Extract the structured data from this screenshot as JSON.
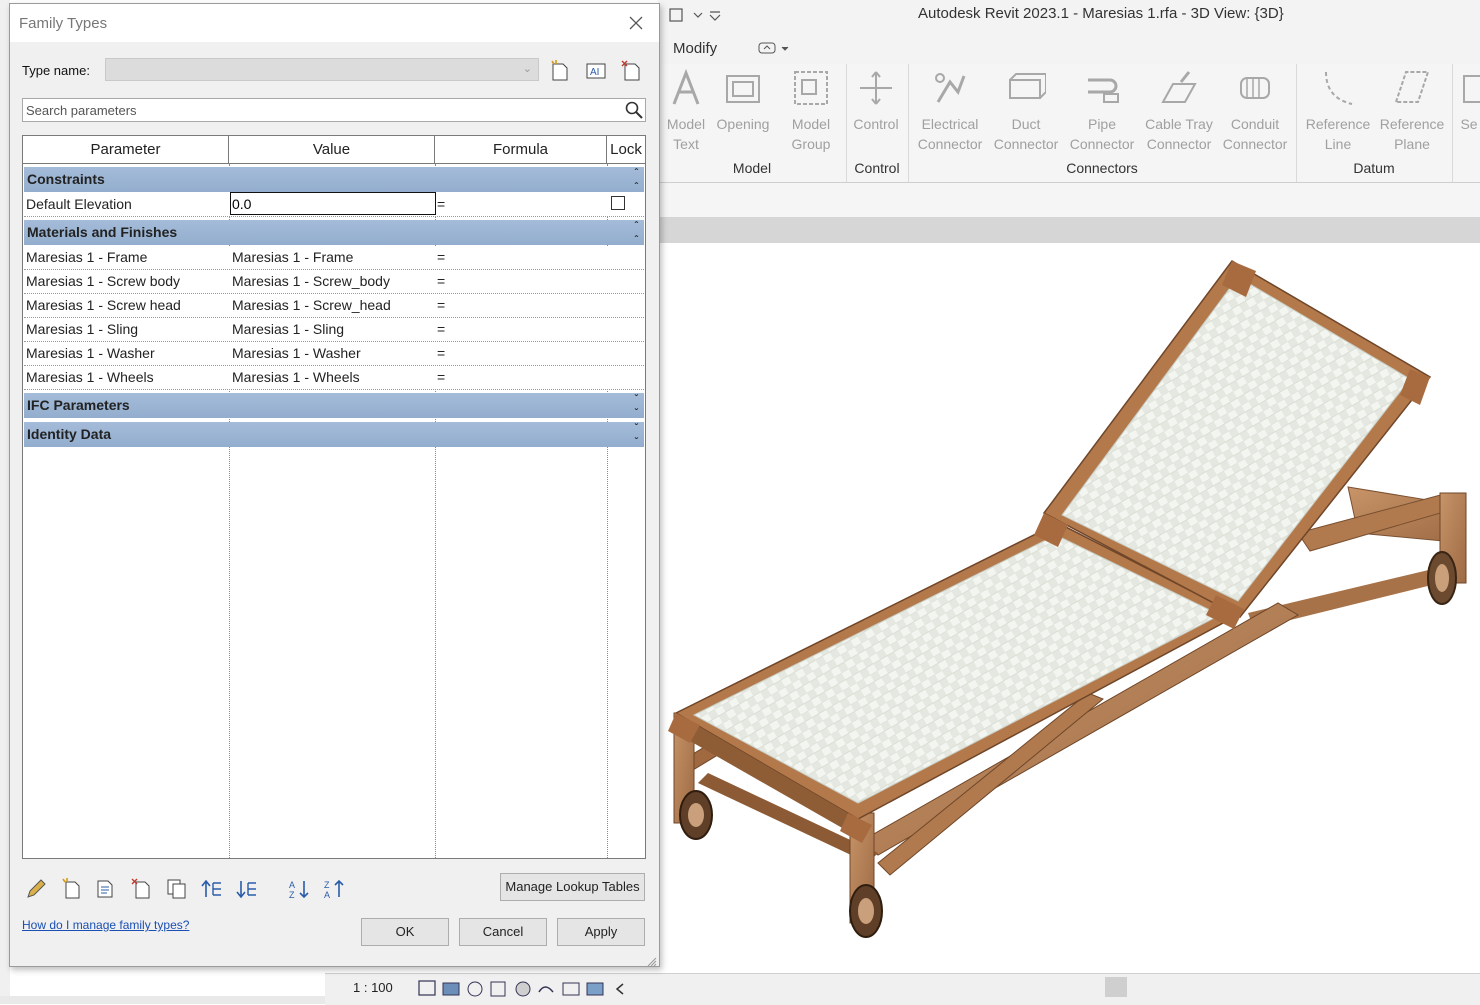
{
  "app": {
    "window_title": "Autodesk Revit 2023.1 - Maresias 1.rfa - 3D View: {3D}",
    "tab_modify": "Modify",
    "ribbon": {
      "buttons": [
        {
          "line1": "Model",
          "line2": "Text",
          "icon": "model-text-icon"
        },
        {
          "line1": "Opening",
          "line2": "",
          "icon": "opening-icon"
        },
        {
          "line1": "Model",
          "line2": "Group",
          "icon": "model-group-icon"
        },
        {
          "line1": "Control",
          "line2": "",
          "icon": "control-icon"
        },
        {
          "line1": "Electrical",
          "line2": "Connector",
          "icon": "electrical-connector-icon"
        },
        {
          "line1": "Duct",
          "line2": "Connector",
          "icon": "duct-connector-icon"
        },
        {
          "line1": "Pipe",
          "line2": "Connector",
          "icon": "pipe-connector-icon"
        },
        {
          "line1": "Cable Tray",
          "line2": "Connector",
          "icon": "cable-tray-connector-icon"
        },
        {
          "line1": "Conduit",
          "line2": "Connector",
          "icon": "conduit-connector-icon"
        },
        {
          "line1": "Reference",
          "line2": "Line",
          "icon": "reference-line-icon"
        },
        {
          "line1": "Reference",
          "line2": "Plane",
          "icon": "reference-plane-icon"
        },
        {
          "line1": "Se",
          "line2": "",
          "icon": "set-icon"
        }
      ],
      "panels": [
        "Model",
        "Control",
        "Connectors",
        "Datum"
      ]
    },
    "status": {
      "scale": "1 : 100"
    }
  },
  "dialog": {
    "title": "Family Types",
    "type_name_label": "Type name:",
    "search_placeholder": "Search parameters",
    "columns": [
      "Parameter",
      "Value",
      "Formula",
      "Lock"
    ],
    "groups": {
      "constraints": {
        "label": "Constraints",
        "rows": [
          {
            "param": "Default Elevation",
            "value": "0.0",
            "formula": "=",
            "lock": false
          }
        ]
      },
      "materials": {
        "label": "Materials and Finishes",
        "rows": [
          {
            "param": "Maresias 1 - Frame",
            "value": "Maresias 1 - Frame",
            "formula": "="
          },
          {
            "param": "Maresias 1 - Screw body",
            "value": "Maresias 1 - Screw_body",
            "formula": "="
          },
          {
            "param": "Maresias 1 - Screw head",
            "value": "Maresias 1 - Screw_head",
            "formula": "="
          },
          {
            "param": "Maresias 1 - Sling",
            "value": "Maresias 1 - Sling",
            "formula": "="
          },
          {
            "param": "Maresias 1 - Washer",
            "value": "Maresias 1 - Washer",
            "formula": "="
          },
          {
            "param": "Maresias 1 - Wheels",
            "value": "Maresias 1 - Wheels",
            "formula": "="
          }
        ]
      },
      "ifc": {
        "label": "IFC Parameters"
      },
      "identity": {
        "label": "Identity Data"
      }
    },
    "manage_lookup_label": "Manage Lookup Tables",
    "help_link": "How do I manage family types?",
    "ok_label": "OK",
    "cancel_label": "Cancel",
    "apply_label": "Apply"
  },
  "colors": {
    "group_header": "#9bb4d3",
    "wood": "#b9825a",
    "sling": "#f2f4ef",
    "link": "#1a4fb3"
  }
}
